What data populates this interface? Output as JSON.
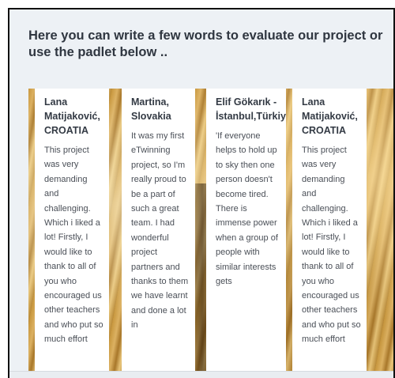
{
  "heading": "Here you can write a  few words to evaluate our project  or use the padlet below ..",
  "cards": [
    {
      "title": "Lana Matijaković, CROATIA",
      "body": "This project was very demanding and challenging. Which i liked a lot! Firstly, I would like to thank to all of you who encouraged us other teachers and who put so much effort"
    },
    {
      "title": "Martina, Slovakia",
      "body": "It was my first eTwinning project, so I'm really  proud to be a part of such a great team. I had wonderful project partners and thanks to them we have learnt and done a lot in"
    },
    {
      "title": "Elif Gökarık - İstanbul,Türkiye",
      "body": "'If everyone helps to hold up to sky then one person doesn't become tired. There is immense power when a group of people with similar interests gets"
    },
    {
      "title": "Lana Matijaković, CROATIA",
      "body": "This project was very demanding and challenging. Which i liked a lot! Firstly, I would like to thank to all of you who encouraged us other teachers and who put so much effort"
    }
  ]
}
